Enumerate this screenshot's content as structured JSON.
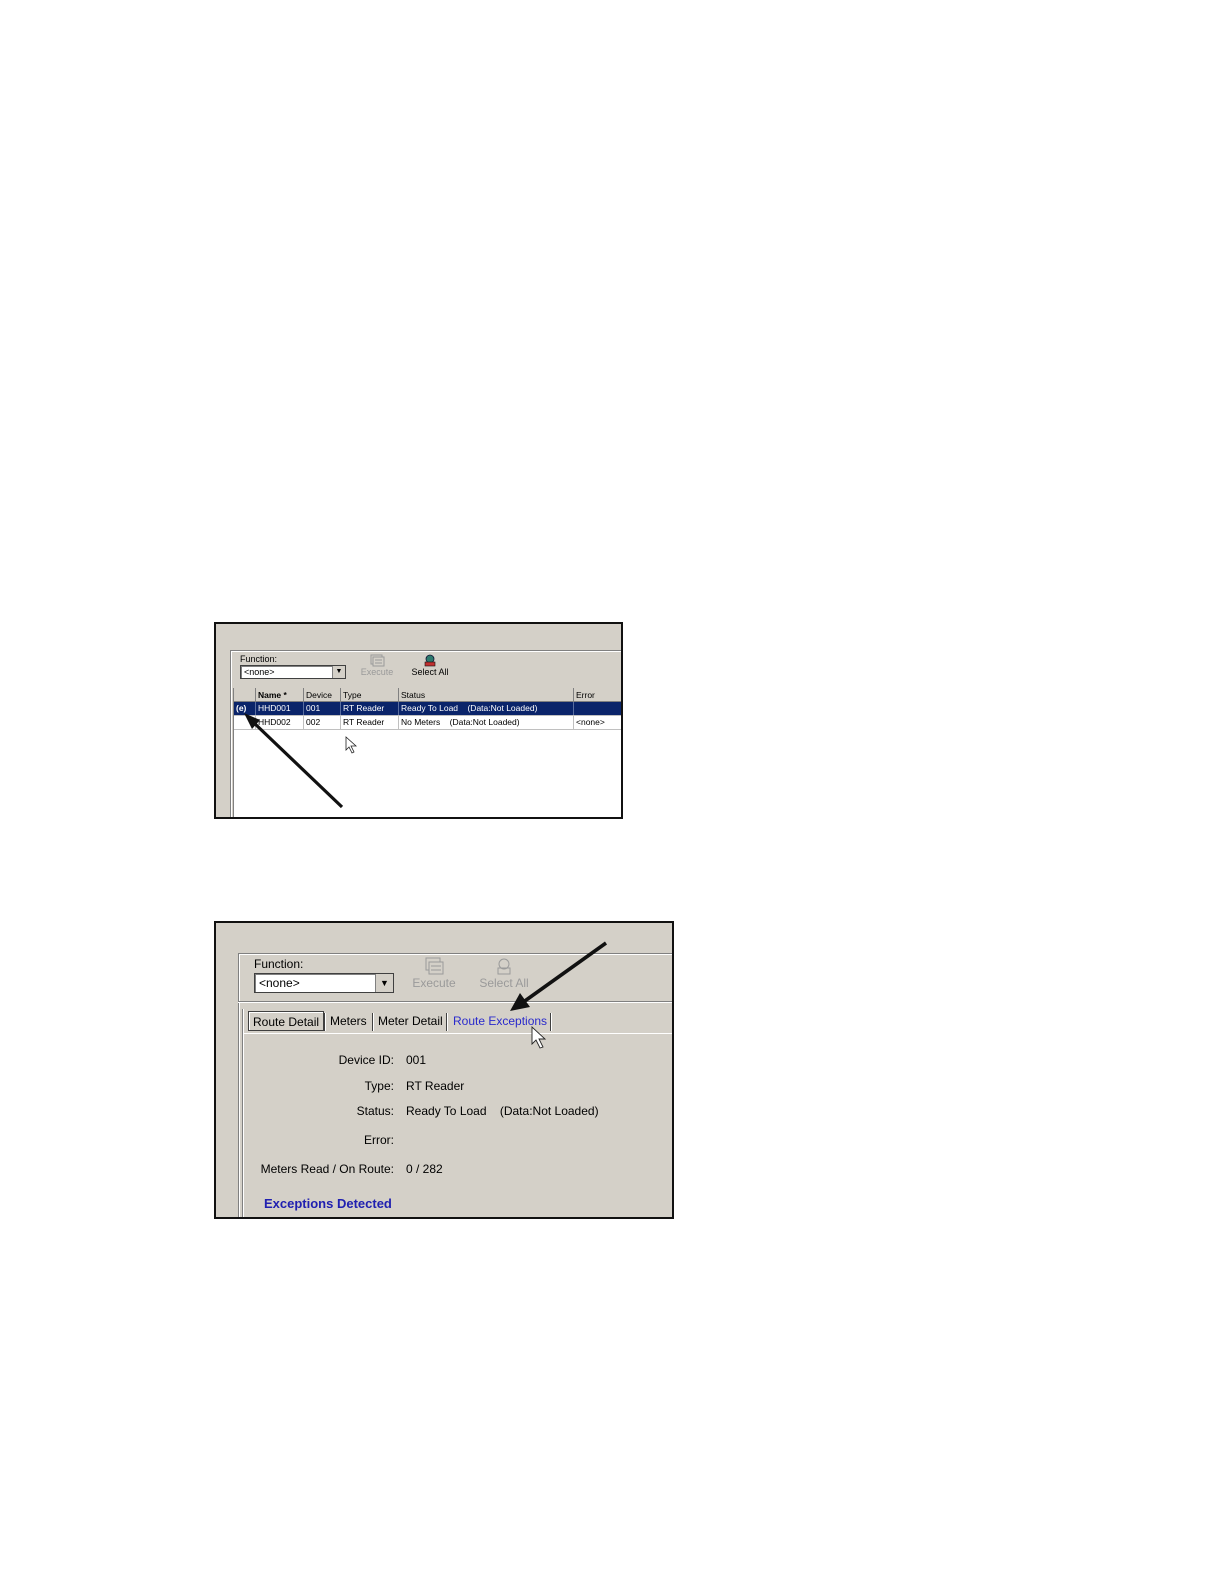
{
  "screenshot1": {
    "function_label": "Function:",
    "function_value": "<none>",
    "execute_label": "Execute",
    "select_all_label": "Select All",
    "columns": [
      "",
      "Name *",
      "Device",
      "Type",
      "Status",
      "Error"
    ],
    "rows": [
      {
        "marker": "(e)",
        "name": "HHD001",
        "device": "001",
        "type": "RT Reader",
        "status": "Ready To Load    (Data:Not Loaded)",
        "error": ""
      },
      {
        "marker": "",
        "name": "HHD002",
        "device": "002",
        "type": "RT Reader",
        "status": "No Meters    (Data:Not Loaded)",
        "error": "<none>"
      }
    ]
  },
  "screenshot2": {
    "function_label": "Function:",
    "function_value": "<none>",
    "execute_label": "Execute",
    "select_all_label": "Select All",
    "tabs": [
      "Route Detail",
      "Meters",
      "Meter Detail",
      "Route Exceptions"
    ],
    "details": [
      {
        "label": "Device ID:",
        "value": "001"
      },
      {
        "label": "Type:",
        "value": "RT Reader"
      },
      {
        "label": "Status:",
        "value": "Ready To Load    (Data:Not Loaded)"
      },
      {
        "label": "Error:",
        "value": ""
      },
      {
        "label": "Meters Read / On Route:",
        "value": "0 / 282"
      }
    ],
    "exceptions_label": "Exceptions Detected"
  }
}
